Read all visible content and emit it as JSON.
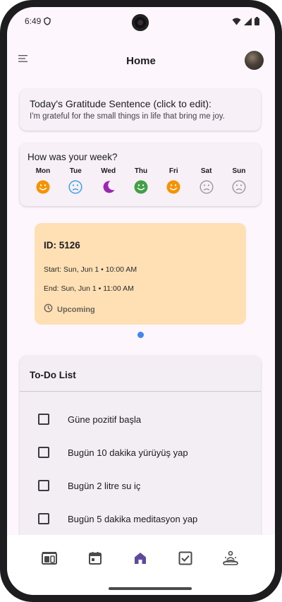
{
  "status_bar": {
    "time": "6:49"
  },
  "app_bar": {
    "title": "Home"
  },
  "gratitude": {
    "title": "Today's Gratitude Sentence (click to edit):",
    "text": "I'm grateful for the small things in life that bring me joy."
  },
  "week": {
    "title": "How was your week?",
    "days": [
      {
        "label": "Mon",
        "mood": "happy-face-icon",
        "color": "#f59300"
      },
      {
        "label": "Tue",
        "mood": "sad-face-icon",
        "color": "#3aa0e0"
      },
      {
        "label": "Wed",
        "mood": "moon-icon",
        "color": "#9c27b0"
      },
      {
        "label": "Thu",
        "mood": "happy-face-icon",
        "color": "#43a047"
      },
      {
        "label": "Fri",
        "mood": "happy-face-icon",
        "color": "#f59300"
      },
      {
        "label": "Sat",
        "mood": "sad-face-icon",
        "color": "#9e9e9e"
      },
      {
        "label": "Sun",
        "mood": "sad-face-icon",
        "color": "#9e9e9e"
      }
    ]
  },
  "event": {
    "id": "ID: 5126",
    "start": "Start: Sun, Jun 1 • 10:00 AM",
    "end": "End: Sun, Jun 1 • 11:00 AM",
    "status": "Upcoming"
  },
  "todo": {
    "title": "To-Do List",
    "items": [
      "Güne pozitif başla",
      "Bugün 10 dakika yürüyüş yap",
      "Bugün 2 litre su iç",
      "Bugün 5 dakika meditasyon yap"
    ]
  },
  "bottom_nav": {
    "items": [
      "photo-album-icon",
      "calendar-icon",
      "home-icon",
      "checkbox-icon",
      "meditation-icon"
    ],
    "active": "home-icon",
    "active_color": "#5e4a9c",
    "inactive_color": "#4a4a4a"
  }
}
